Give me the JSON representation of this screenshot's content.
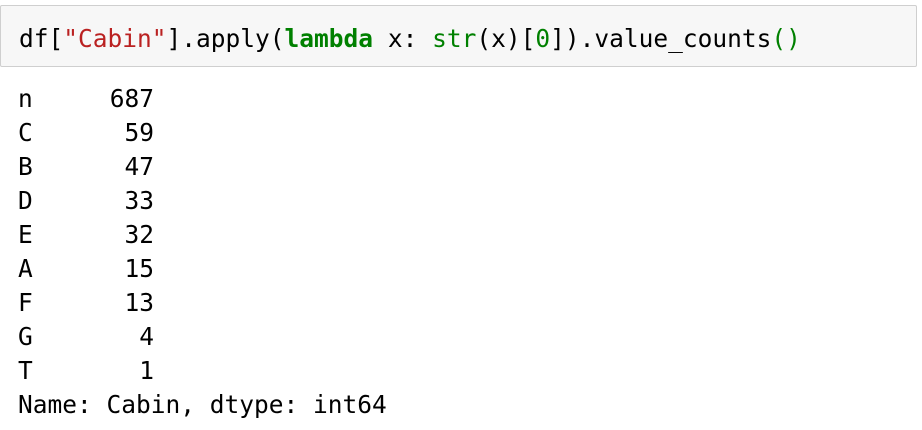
{
  "input_cell": {
    "code_tokens": [
      {
        "text": "df[",
        "kind": "plain"
      },
      {
        "text": "\"Cabin\"",
        "kind": "str"
      },
      {
        "text": "].apply(",
        "kind": "plain"
      },
      {
        "text": "lambda",
        "kind": "kw"
      },
      {
        "text": " x: ",
        "kind": "plain"
      },
      {
        "text": "str",
        "kind": "builtin"
      },
      {
        "text": "(x)[",
        "kind": "plain"
      },
      {
        "text": "0",
        "kind": "num"
      },
      {
        "text": "]).value_counts",
        "kind": "plain"
      },
      {
        "text": "()",
        "kind": "paren"
      }
    ]
  },
  "output": {
    "rows": [
      {
        "key": "n",
        "value": "687"
      },
      {
        "key": "C",
        "value": "59"
      },
      {
        "key": "B",
        "value": "47"
      },
      {
        "key": "D",
        "value": "33"
      },
      {
        "key": "E",
        "value": "32"
      },
      {
        "key": "A",
        "value": "15"
      },
      {
        "key": "F",
        "value": "13"
      },
      {
        "key": "G",
        "value": "4"
      },
      {
        "key": "T",
        "value": "1"
      }
    ],
    "footer": "Name: Cabin, dtype: int64"
  },
  "colors": {
    "string": "#ba2121",
    "keyword": "#008000",
    "cell_background": "#f7f7f7",
    "cell_border": "#cfcfcf"
  }
}
